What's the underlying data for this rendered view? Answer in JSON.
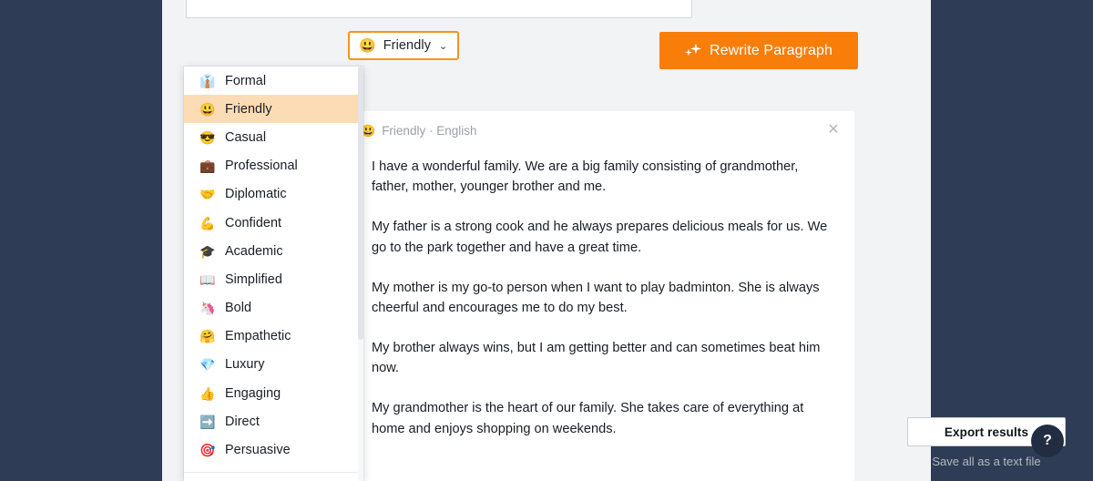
{
  "theme": {
    "navy": "#2e3c55",
    "page_bg": "#f2f3f5",
    "accent_orange": "#f97d09",
    "highlight_peach": "#fcdcb4",
    "badge_blue": "#1a8cff"
  },
  "editor": {
    "textarea_value": "",
    "textarea_placeholder": "",
    "verified_icon": "verified-check-icon"
  },
  "tone_selector": {
    "emoji": "😃",
    "label": "Friendly",
    "chevron": "⌄",
    "expanded": true
  },
  "rewrite": {
    "icon": "sparkles-icon",
    "label": "Rewrite Paragraph"
  },
  "dropdown": {
    "selected": "Friendly",
    "items": [
      {
        "emoji": "👔",
        "label": "Formal",
        "icon_name": "necktie-icon"
      },
      {
        "emoji": "😃",
        "label": "Friendly",
        "icon_name": "smiling-face-icon"
      },
      {
        "emoji": "😎",
        "label": "Casual",
        "icon_name": "sunglasses-face-icon"
      },
      {
        "emoji": "💼",
        "label": "Professional",
        "icon_name": "briefcase-icon"
      },
      {
        "emoji": "🤝",
        "label": "Diplomatic",
        "icon_name": "handshake-icon"
      },
      {
        "emoji": "💪",
        "label": "Confident",
        "icon_name": "flexed-biceps-icon"
      },
      {
        "emoji": "🎓",
        "label": "Academic",
        "icon_name": "graduation-cap-icon"
      },
      {
        "emoji": "📖",
        "label": "Simplified",
        "icon_name": "open-book-icon"
      },
      {
        "emoji": "🦄",
        "label": "Bold",
        "icon_name": "unicorn-icon"
      },
      {
        "emoji": "🤗",
        "label": "Empathetic",
        "icon_name": "hugging-face-icon"
      },
      {
        "emoji": "💎",
        "label": "Luxury",
        "icon_name": "gem-icon"
      },
      {
        "emoji": "👍",
        "label": "Engaging",
        "icon_name": "thumbs-up-icon"
      },
      {
        "emoji": "➡️",
        "label": "Direct",
        "icon_name": "right-arrow-icon"
      },
      {
        "emoji": "🎯",
        "label": "Persuasive",
        "icon_name": "dart-target-icon"
      }
    ]
  },
  "result_card": {
    "meta_emoji": "😃",
    "meta_text": "Friendly · English",
    "close_label": "✕",
    "paragraphs": [
      "I have a wonderful family. We are a big family consisting of grandmother, father, mother, younger brother and me.",
      "My father is a strong cook and he always prepares delicious meals for us. We go to the park together and have a great time.",
      "My mother is my go-to person when I want to play badminton. She is always cheerful and encourages me to do my best.",
      "My brother always wins, but I am getting better and can sometimes beat him now.",
      "My grandmother is the heart of our family. She takes care of everything at home and enjoys shopping on weekends."
    ]
  },
  "export": {
    "button_label": "Export results",
    "hint": "Save all as a text file"
  },
  "help": {
    "label": "?",
    "icon_name": "question-mark-icon"
  }
}
